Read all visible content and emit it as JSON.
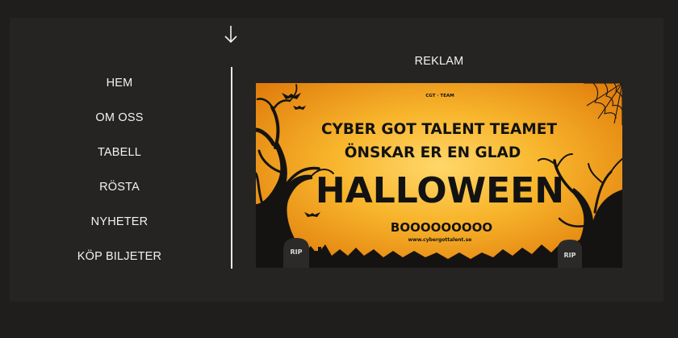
{
  "nav": {
    "items": [
      {
        "label": "HEM"
      },
      {
        "label": "OM OSS"
      },
      {
        "label": "TABELL"
      },
      {
        "label": "RÖSTA"
      },
      {
        "label": "NYHETER"
      },
      {
        "label": "KÖP BILJETER"
      }
    ]
  },
  "ad": {
    "label": "REKLAM",
    "banner": {
      "brand": "CGT · TEAM",
      "line1": "CYBER GOT TALENT TEAMET",
      "line2": "ÖNSKAR ER EN GLAD",
      "headline": "HALLOWEEN",
      "boo": "BOOOOOOOOO",
      "url": "www.cybergottalent.se",
      "grave_text": "RIP"
    }
  },
  "colors": {
    "page_bg": "#1f1e1d",
    "panel_bg": "#252423",
    "text": "#f2f2f2",
    "banner_orange": "#f6a21c",
    "banner_dark": "#121212"
  }
}
